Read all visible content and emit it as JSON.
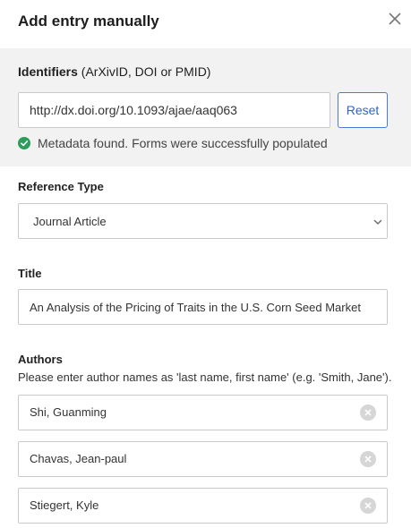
{
  "dialog": {
    "title": "Add entry manually",
    "close_icon": "close-icon"
  },
  "identifiers": {
    "label_bold": "Identifiers",
    "label_rest": " (ArXivID, DOI or PMID)",
    "value": "http://dx.doi.org/10.1093/ajae/aaq063",
    "reset_label": "Reset",
    "status_icon": "check-circle-icon",
    "status_color": "#2e9c5a",
    "status_text": "Metadata found. Forms were successfully populated"
  },
  "reference_type": {
    "label": "Reference Type",
    "selected": "Journal Article",
    "chevron_icon": "chevron-down-icon"
  },
  "title_field": {
    "label": "Title",
    "value": "An Analysis of the Pricing of Traits in the U.S. Corn Seed Market"
  },
  "authors": {
    "label": "Authors",
    "hint": "Please enter author names as 'last name, first name' (e.g. 'Smith, Jane').",
    "remove_icon": "remove-x-icon",
    "items": [
      {
        "name": "Shi, Guanming"
      },
      {
        "name": "Chavas, Jean-paul"
      },
      {
        "name": "Stiegert, Kyle"
      }
    ]
  },
  "colors": {
    "accent": "#2f64c8",
    "section_bg": "#f2f2f2",
    "border": "#c9c9c9"
  }
}
